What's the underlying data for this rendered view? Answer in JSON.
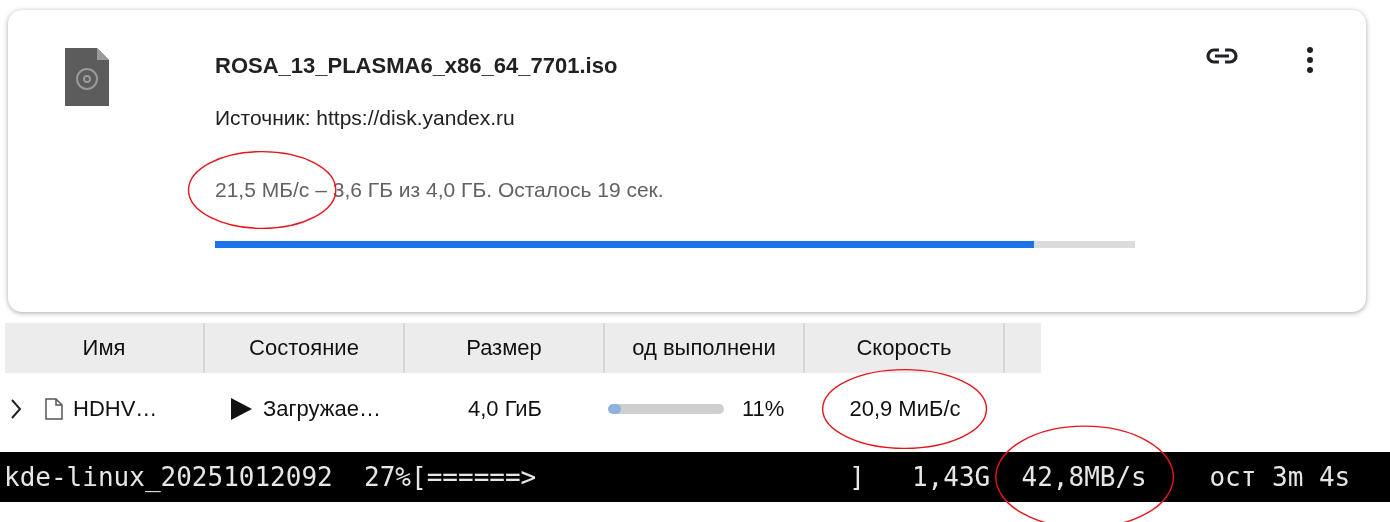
{
  "download_card": {
    "filename": "ROSA_13_PLASMA6_x86_64_7701.iso",
    "source": "Источник: https://disk.yandex.ru",
    "speed": {
      "text": "21,5 МБ/с",
      "annotated": true
    },
    "progress_text": "– 3,6 ГБ из 4,0 ГБ. Осталось 19 сек.",
    "level": 0.89
  },
  "table": {
    "columns": [
      "Имя",
      "Состояние",
      "Размер",
      "од выполнени",
      "Скорость"
    ],
    "rows": [
      {
        "expanded": false,
        "name": "HDHV…",
        "status": "Загружае…",
        "size": "4,0 ГиБ",
        "level": 0.11,
        "percent": "11%",
        "speed": {
          "text": "20,9 МиБ/с",
          "annotated": true
        }
      }
    ]
  },
  "terminal": {
    "filename": "kde-linux_20251012092",
    "percent": "27%",
    "bar": "[======>                    ]",
    "size": "1,43G",
    "speed": {
      "text": "42,8MB/s",
      "annotated": true
    },
    "eta": "ост 3m 4s"
  }
}
